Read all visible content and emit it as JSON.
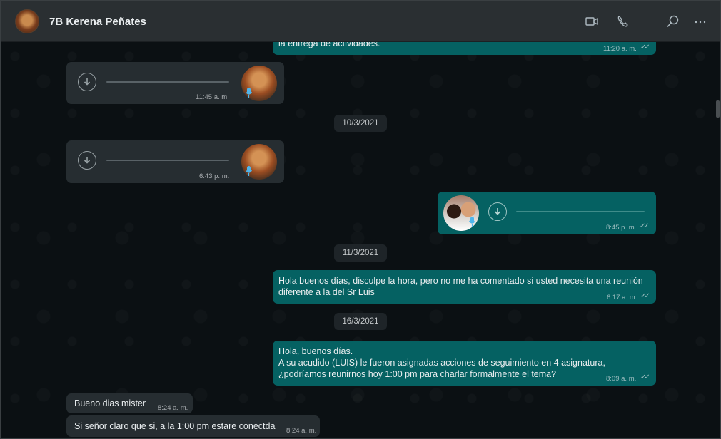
{
  "header": {
    "contact_name": "7B Kerena Peñates",
    "icons": [
      "video-call-icon",
      "voice-call-icon",
      "search-icon",
      "more-options-icon"
    ]
  },
  "messages": {
    "m0": {
      "text": "la entrega de actividades.",
      "time": "11:20 a. m."
    },
    "voice1": {
      "time": "11:45 a. m."
    },
    "date1": "10/3/2021",
    "voice2": {
      "time": "6:43 p. m."
    },
    "voice3": {
      "time": "8:45 p. m."
    },
    "date2": "11/3/2021",
    "m1": {
      "text": "Hola buenos días, disculpe la hora, pero no me ha comentado si usted necesita una reunión\ndiferente a la del Sr Luis",
      "time": "6:17 a. m."
    },
    "date3": "16/3/2021",
    "m2": {
      "text": "Hola, buenos días.\nA su acudido (LUIS) le fueron asignadas acciones de seguimiento en 4 asignatura,\n¿podríamos reunirnos hoy 1:00 pm para charlar formalmente el tema?",
      "time": "8:09 a. m."
    },
    "m3": {
      "text": "Bueno dias mister",
      "time": "8:24 a. m."
    },
    "m4": {
      "text": "Si señor claro que si, a la 1:00 pm estare conectda",
      "time": "8:24 a. m."
    }
  },
  "colors": {
    "header_bg": "#2a2f32",
    "chat_bg": "#0b1013",
    "incoming_bubble": "#262d31",
    "outgoing_bubble": "#056162"
  }
}
